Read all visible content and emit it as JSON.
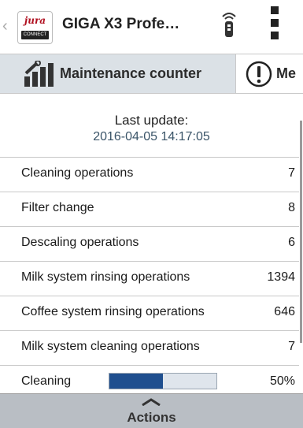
{
  "header": {
    "title": "GIGA X3 Profe…",
    "logo_brand": "jura",
    "logo_sub": "CONNECT"
  },
  "tabs": [
    {
      "label": "Maintenance counter",
      "icon": "bar-chart-wrench-icon",
      "active": true
    },
    {
      "label": "Me",
      "icon": "exclamation-circle-icon",
      "active": false
    }
  ],
  "update": {
    "label": "Last update:",
    "timestamp": "2016-04-05 14:17:05"
  },
  "counters": [
    {
      "label": "Cleaning operations",
      "value": "7"
    },
    {
      "label": "Filter change",
      "value": "8"
    },
    {
      "label": "Descaling operations",
      "value": "6"
    },
    {
      "label": "Milk system rinsing operations",
      "value": "1394"
    },
    {
      "label": "Coffee system rinsing operations",
      "value": "646"
    },
    {
      "label": "Milk system cleaning operations",
      "value": "7"
    }
  ],
  "cleaning_status": {
    "label": "Cleaning",
    "percent_text": "50%",
    "progress_fraction": 0.5
  },
  "footer": {
    "actions_label": "Actions"
  },
  "colors": {
    "progress_fill": "#1f4f8f",
    "tab_active_bg": "#dbe1e6",
    "footer_bg": "#b9bec4",
    "brand_red": "#b01020"
  }
}
